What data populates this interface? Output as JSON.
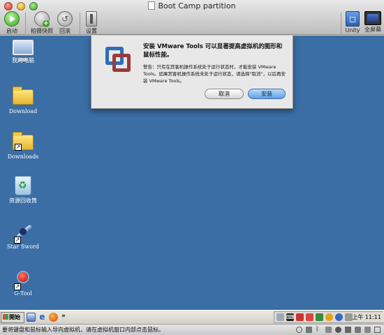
{
  "window": {
    "title": "Boot Camp partition"
  },
  "toolbar": {
    "start_label": "启动",
    "snapshot_label": "拍摄快照",
    "revert_label": "回滚",
    "settings_label": "设置",
    "unity_label": "Unity",
    "fullscreen_label": "全屏幕"
  },
  "desktop_icons": [
    {
      "label": "我的电脑",
      "icon": "computer-icon"
    },
    {
      "label": "Download",
      "icon": "folder-icon"
    },
    {
      "label": "Downloads",
      "icon": "folder-shortcut-icon"
    },
    {
      "label": "资源回收筒",
      "icon": "recycle-bin-icon"
    },
    {
      "label": "Star Sword",
      "icon": "star-sword-icon"
    },
    {
      "label": "G-Tool",
      "icon": "g-tool-icon"
    }
  ],
  "dialog": {
    "title": "安装 VMware Tools 可以显著提高虚拟机的图形和鼠标性能。",
    "body": "警告：只有在宾客机操作系统处于运行状态时，才能安装 VMware Tools。如果宾客机操作系统未处于运行状态，请选择\"取消\"，以后再安装 VMware Tools。",
    "cancel_label": "取消",
    "install_label": "安装"
  },
  "taskbar": {
    "start_label": "開始",
    "more": "»",
    "clock": "上午 11:11"
  },
  "statusbar": {
    "text": "要将键盘和鼠标输入导向虚拟机，请在虚拟机窗口内部点击鼠标。"
  }
}
